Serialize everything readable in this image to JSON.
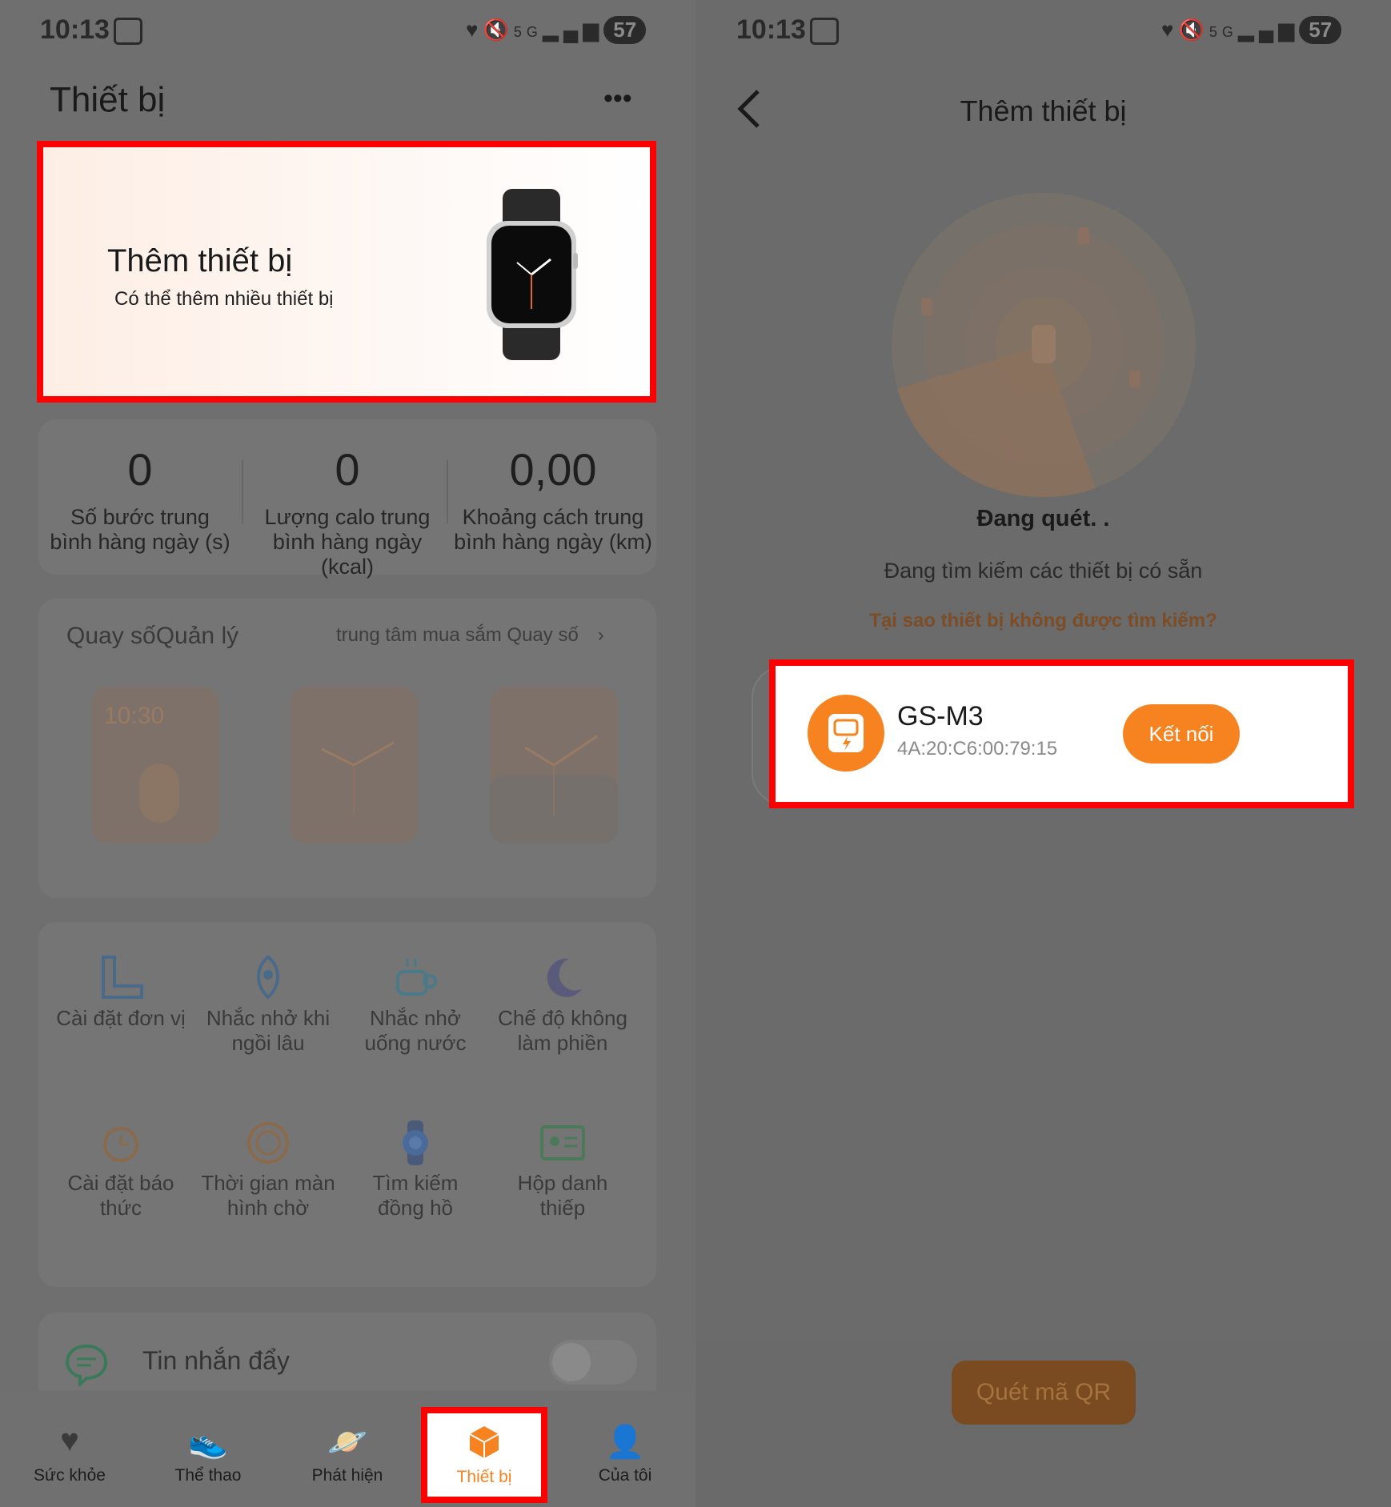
{
  "status": {
    "time": "10:13",
    "battery": "57",
    "net": "5G"
  },
  "left": {
    "title": "Thiết bị",
    "more_label": "•••",
    "add_card": {
      "title": "Thêm thiết bị",
      "subtitle": "Có thể thêm nhiều thiết bị"
    },
    "stats": [
      {
        "value": "0",
        "label": "Số bước trung bình hàng ngày (s)"
      },
      {
        "value": "0",
        "label": "Lượng calo trung bình hàng ngày (kcal)"
      },
      {
        "value": "0,00",
        "label": "Khoảng cách trung bình hàng ngày (km)"
      }
    ],
    "dial": {
      "title": "Quay sốQuản lý",
      "link": "trung tâm mua sắm Quay số",
      "face_time": "10:30"
    },
    "tools": [
      {
        "label": "Cài đặt đơn vị",
        "icon": "ruler-icon"
      },
      {
        "label": "Nhắc nhở khi ngồi lâu",
        "icon": "rocket-icon"
      },
      {
        "label": "Nhắc nhở uống nước",
        "icon": "cup-icon"
      },
      {
        "label": "Chế độ không làm phiền",
        "icon": "moon-icon"
      },
      {
        "label": "Cài đặt báo thức",
        "icon": "alarm-icon"
      },
      {
        "label": "Thời gian màn hình chờ",
        "icon": "screen-timer-icon"
      },
      {
        "label": "Tìm kiếm đồng hồ",
        "icon": "watch-search-icon"
      },
      {
        "label": "Hộp danh thiếp",
        "icon": "card-icon"
      }
    ],
    "push": {
      "label": "Tin nhắn đẩy",
      "enabled": false
    },
    "nav": [
      {
        "label": "Sức khỏe",
        "icon": "heart-icon"
      },
      {
        "label": "Thể thao",
        "icon": "shoe-icon"
      },
      {
        "label": "Phát hiện",
        "icon": "planet-icon"
      },
      {
        "label": "Thiết bị",
        "icon": "device-box-icon"
      },
      {
        "label": "Của tôi",
        "icon": "user-icon"
      }
    ]
  },
  "right": {
    "title": "Thêm thiết bị",
    "scan_status": "Đang quét. .",
    "scan_desc": "Đang tìm kiếm các thiết bị có sẵn",
    "help_link": "Tại sao thiết bị không được tìm kiếm?",
    "device": {
      "name": "GS-M3",
      "mac": "4A:20:C6:00:79:15",
      "connect_label": "Kết nối"
    },
    "qr_button": "Quét mã QR"
  },
  "colors": {
    "accent": "#f6831f",
    "highlight": "#ff0000"
  }
}
